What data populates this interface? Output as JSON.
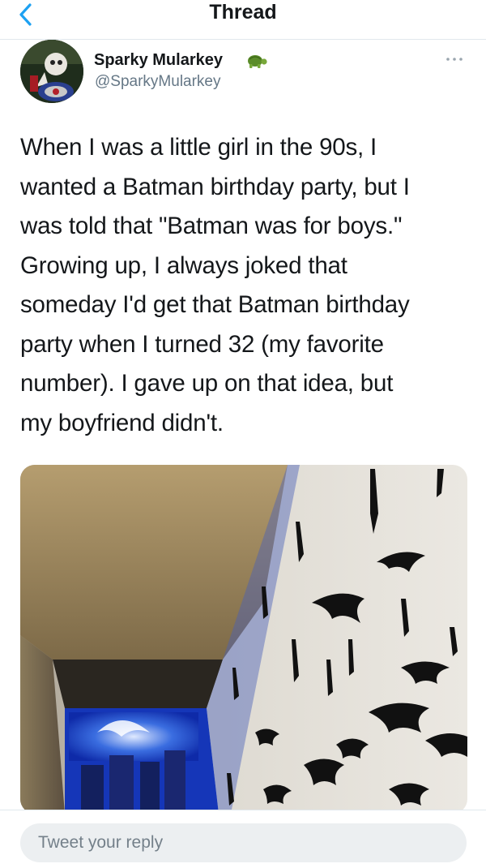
{
  "nav": {
    "back_icon": "chevron-left-icon",
    "title": "Thread"
  },
  "tweet": {
    "author_name": "Sparky Mularkey",
    "author_handle": "@SparkyMularkey",
    "name_emoji_icon": "turtle-icon",
    "more_icon": "more-horizontal-icon",
    "text_lines": [
      "When I was a little girl in the 90s, I",
      "wanted a Batman birthday party, but I",
      "was told that \"Batman was for boys.\"",
      "Growing up, I always joked that",
      "someday I'd get that Batman birthday",
      "party when I turned 32 (my favorite",
      "number). I gave up on that idea, but",
      "my boyfriend didn't."
    ]
  },
  "reply": {
    "placeholder": "Tweet your reply"
  },
  "colors": {
    "accent": "#1da1f2",
    "text": "#14171a",
    "secondary_text": "#657786",
    "reply_bg": "#eceff1"
  }
}
